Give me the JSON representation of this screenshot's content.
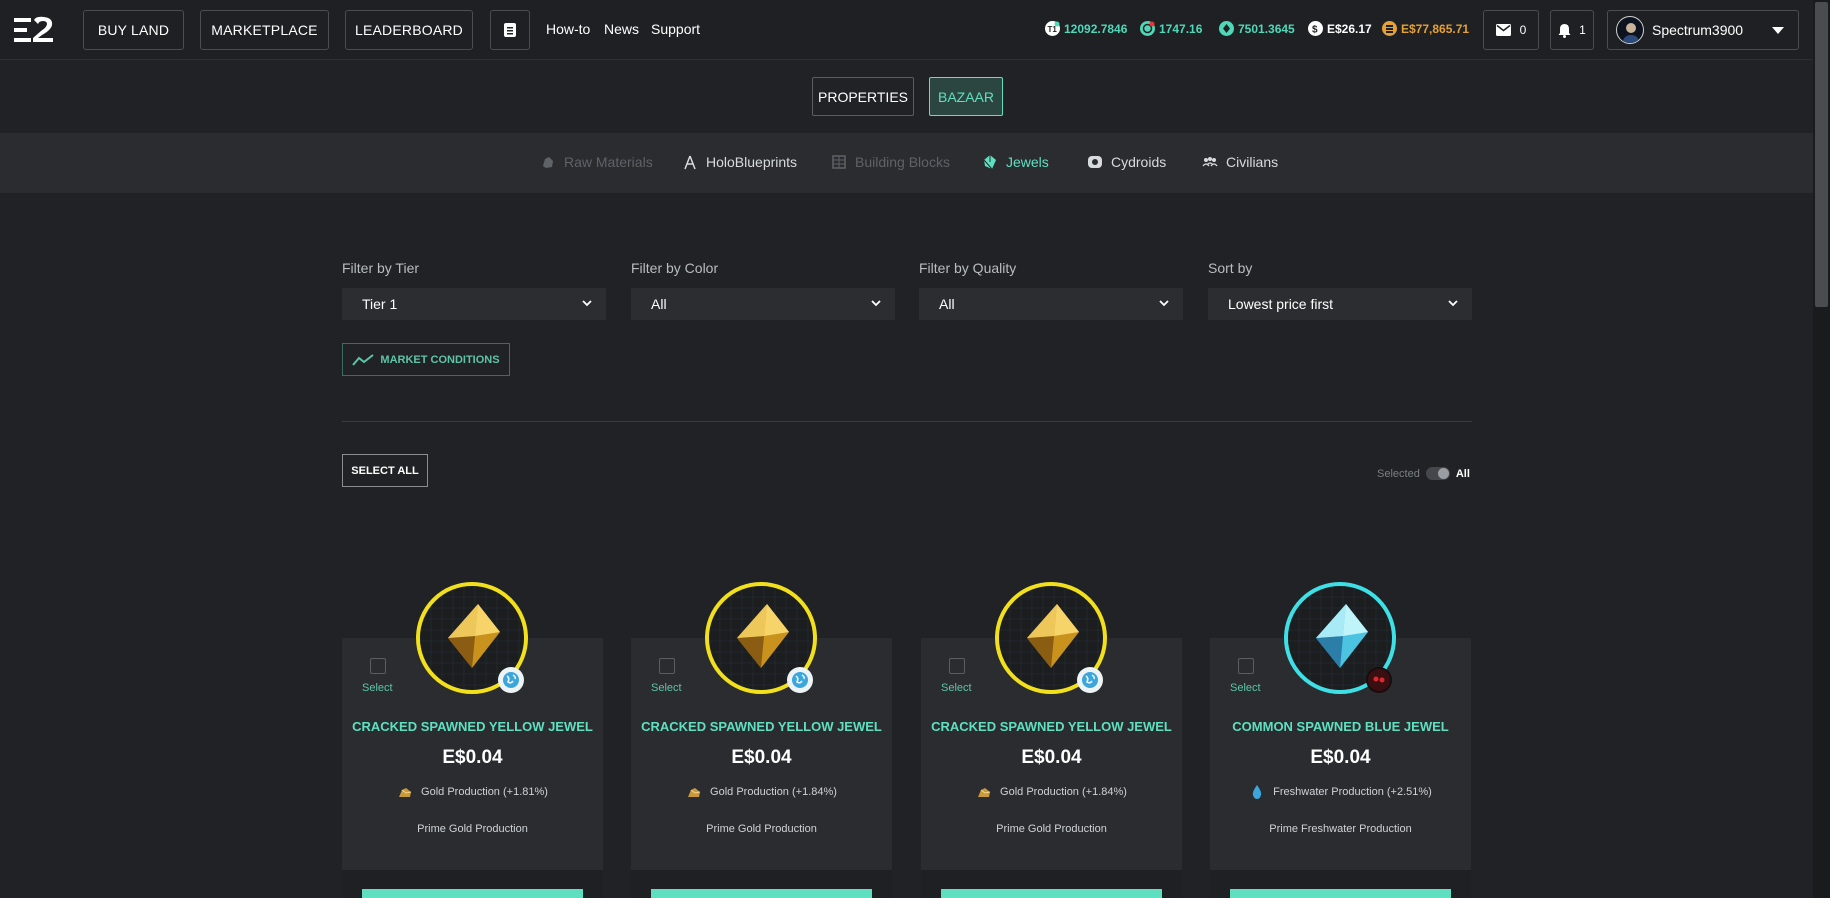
{
  "nav": {
    "buttons": [
      "BUY LAND",
      "MARKETPLACE",
      "LEADERBOARD"
    ],
    "links": [
      "How-to",
      "News",
      "Support"
    ]
  },
  "balances": [
    {
      "icon": "t1-token-icon",
      "value": "12092.7846",
      "color": "#4fd8b8"
    },
    {
      "icon": "essence-icon",
      "value": "1747.16",
      "color": "#4fd8b8"
    },
    {
      "icon": "gem-token-icon",
      "value": "7501.3645",
      "color": "#4fd8b8"
    },
    {
      "icon": "dollar-icon",
      "value": "E$26.17",
      "color": "#ffffff"
    },
    {
      "icon": "coin-stack-icon",
      "value": "E$77,865.71",
      "color": "#e5a133"
    }
  ],
  "inbox": {
    "count": "0"
  },
  "notifications": {
    "count": "1"
  },
  "user": {
    "name": "Spectrum3900"
  },
  "subtabs": [
    "PROPERTIES",
    "BAZAAR"
  ],
  "categories": [
    {
      "label": "Raw Materials",
      "icon": "ore-icon",
      "state": "disabled"
    },
    {
      "label": "HoloBlueprints",
      "icon": "compass-icon",
      "state": "normal"
    },
    {
      "label": "Building Blocks",
      "icon": "blocks-icon",
      "state": "disabled"
    },
    {
      "label": "Jewels",
      "icon": "jewel-icon",
      "state": "active"
    },
    {
      "label": "Cydroids",
      "icon": "cydroid-icon",
      "state": "normal"
    },
    {
      "label": "Civilians",
      "icon": "civilians-icon",
      "state": "normal"
    }
  ],
  "filters": [
    {
      "label": "Filter by Tier",
      "value": "Tier 1"
    },
    {
      "label": "Filter by Color",
      "value": "All"
    },
    {
      "label": "Filter by Quality",
      "value": "All"
    },
    {
      "label": "Sort by",
      "value": "Lowest price first"
    }
  ],
  "market_conditions": "MARKET CONDITIONS",
  "select_all": "SELECT ALL",
  "view_toggle": {
    "left": "Selected",
    "right": "All"
  },
  "cards": [
    {
      "select_label": "Select",
      "name": "CRACKED SPAWNED YELLOW JEWEL",
      "price": "E$0.04",
      "attribute": "Gold Production (+1.81%)",
      "subtitle": "Prime Gold Production",
      "ring_color": "#f2e01c",
      "jewel_color": "yellow",
      "badge": "globe-icon"
    },
    {
      "select_label": "Select",
      "name": "CRACKED SPAWNED YELLOW JEWEL",
      "price": "E$0.04",
      "attribute": "Gold Production (+1.84%)",
      "subtitle": "Prime Gold Production",
      "ring_color": "#f2e01c",
      "jewel_color": "yellow",
      "badge": "globe-icon"
    },
    {
      "select_label": "Select",
      "name": "CRACKED SPAWNED YELLOW JEWEL",
      "price": "E$0.04",
      "attribute": "Gold Production (+1.84%)",
      "subtitle": "Prime Gold Production",
      "ring_color": "#f2e01c",
      "jewel_color": "yellow",
      "badge": "globe-icon"
    },
    {
      "select_label": "Select",
      "name": "COMMON SPAWNED BLUE JEWEL",
      "price": "E$0.04",
      "attribute": "Freshwater Production (+2.51%)",
      "subtitle": "Prime Freshwater Production",
      "ring_color": "#3ee0e6",
      "jewel_color": "blue",
      "badge": "red-creature-icon"
    }
  ]
}
